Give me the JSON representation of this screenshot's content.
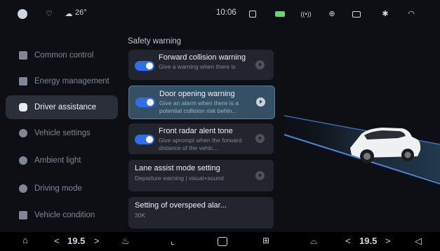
{
  "status_bar": {
    "temperature": "26°",
    "time": "10:06",
    "icons": [
      "profile-icon",
      "seatbelt-alert-icon",
      "cloud-icon",
      "car-lock-icon",
      "battery-icon",
      "signal-icon",
      "location-icon",
      "camera-icon",
      "bluetooth-icon",
      "wifi-icon"
    ]
  },
  "sidebar": {
    "items": [
      {
        "label": "Common control",
        "icon": "common-control-icon"
      },
      {
        "label": "Energy management",
        "icon": "battery-icon"
      },
      {
        "label": "Driver assistance",
        "icon": "car-icon",
        "active": true
      },
      {
        "label": "Vehicle settings",
        "icon": "settings-icon"
      },
      {
        "label": "Ambient light",
        "icon": "light-icon"
      },
      {
        "label": "Driving mode",
        "icon": "steering-icon"
      },
      {
        "label": "Vehicle condition",
        "icon": "condition-icon"
      }
    ]
  },
  "main": {
    "section_title": "Safety warning",
    "cards": [
      {
        "title": "Forward collision warning",
        "desc": "Give a warning when there is",
        "toggle_on": true
      },
      {
        "title": "Door opening warning",
        "desc": "Give an alarm when there is a potential collision risk behin...",
        "toggle_on": true,
        "active": true
      },
      {
        "title": "Front radar alent tone",
        "desc": "Give aprompt when the forward distance of the vehic...",
        "toggle_on": true
      },
      {
        "title": "Lane assist mode setting",
        "desc": "Departure warning | visual+sound"
      },
      {
        "title": "Setting of overspeed alar...",
        "desc": "30K"
      }
    ]
  },
  "bottom_bar": {
    "left_temp": "19.5",
    "right_temp": "19.5",
    "prev": "<",
    "next": ">"
  },
  "colors": {
    "accent": "#2f6ee6",
    "active_card": "#355064",
    "background": "#0d0f14"
  }
}
